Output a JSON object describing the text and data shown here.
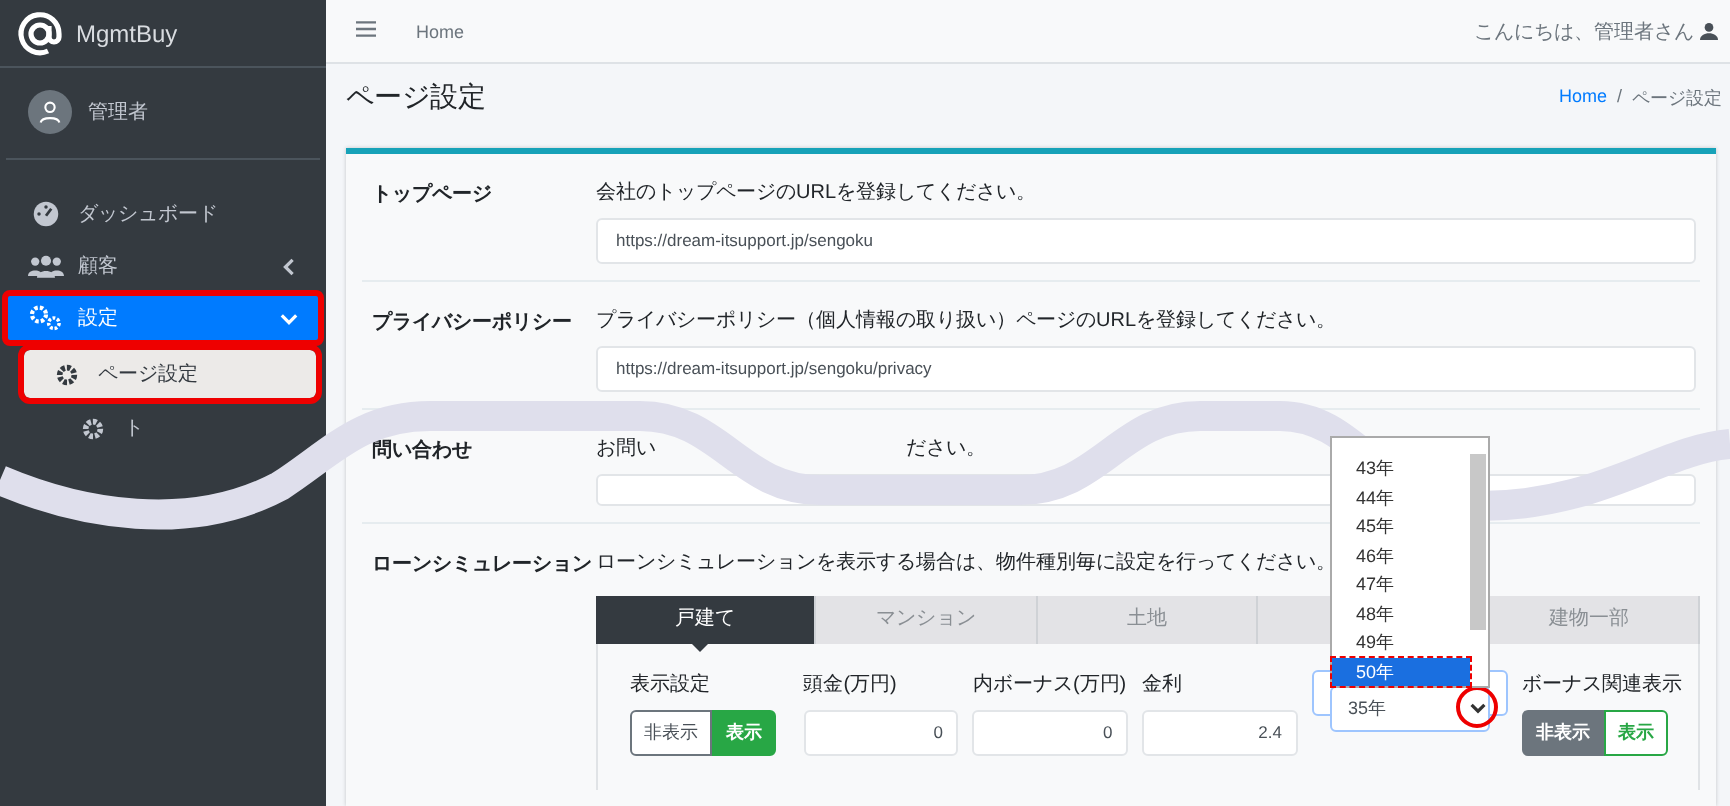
{
  "brand": {
    "name": "MgmtBuy"
  },
  "user": {
    "name": "管理者"
  },
  "sidebar": {
    "items": [
      {
        "label": "ダッシュボード",
        "selected": false,
        "annotated": false
      },
      {
        "label": "顧客",
        "selected": false,
        "annotated": false,
        "expanded": false
      },
      {
        "label": "設定",
        "selected": true,
        "annotated": true,
        "expanded": true,
        "children": [
          {
            "label": "ページ設定",
            "selected": true,
            "annotated": true
          },
          {
            "label": "ト",
            "selected": false,
            "annotated": false
          }
        ]
      }
    ]
  },
  "topbar": {
    "breadcrumb": "Home",
    "greeting": "こんにちは、管理者さん"
  },
  "page": {
    "title": "ページ設定",
    "separator": "/",
    "breadcrumb": [
      {
        "label": "Home",
        "link": true
      },
      {
        "label": "ページ設定",
        "link": false
      }
    ]
  },
  "settings": [
    {
      "label": "トップページ",
      "description": [
        "会社のトップページのURLを登録してください。"
      ],
      "value": "https://dream-itsupport.jp/sengoku"
    },
    {
      "label": "プライバシーポリシー",
      "description": [
        "プライバシーポリシー（個人情報の取り扱い）ページのURLを登録してください。"
      ],
      "value": "https://dream-itsupport.jp/sengoku/privacy"
    },
    {
      "label": "問い合わせ",
      "description": [
        "お問い",
        "ださい。"
      ]
    }
  ],
  "loan": {
    "label": "ローンシミュレーション",
    "description": "ローンシミュレーションを表示する場合は、物件種別毎に設定を行ってください。",
    "tabs": [
      {
        "label": "戸建て",
        "selected": true
      },
      {
        "label": "マンション",
        "selected": false
      },
      {
        "label": "土地",
        "selected": false
      },
      {
        "selected": false
      },
      {
        "label": "建物一部",
        "selected": false
      }
    ],
    "fields": [
      {
        "kind": "toggle",
        "label": "表示設定",
        "options": [
          {
            "label": "非表示",
            "selected": false
          },
          {
            "label": "表示",
            "selected": true
          }
        ]
      },
      {
        "kind": "number",
        "label": "頭金(万円)",
        "value": "0"
      },
      {
        "kind": "number",
        "label": "内ボーナス(万円)",
        "value": "0"
      },
      {
        "kind": "number",
        "label": "金利",
        "value": "2.4"
      },
      {
        "kind": "select",
        "value": "35年",
        "expanded": true,
        "annotated": true,
        "options": [
          {
            "label": "43年",
            "selected": false
          },
          {
            "label": "44年",
            "selected": false
          },
          {
            "label": "45年",
            "selected": false
          },
          {
            "label": "46年",
            "selected": false
          },
          {
            "label": "47年",
            "selected": false
          },
          {
            "label": "48年",
            "selected": false
          },
          {
            "label": "49年",
            "selected": false
          },
          {
            "label": "50年",
            "selected": true
          }
        ]
      },
      {
        "kind": "toggle",
        "label": "ボーナス関連表示",
        "options": [
          {
            "label": "非表示",
            "selected": true
          },
          {
            "label": "表示",
            "selected": false
          }
        ]
      }
    ]
  }
}
